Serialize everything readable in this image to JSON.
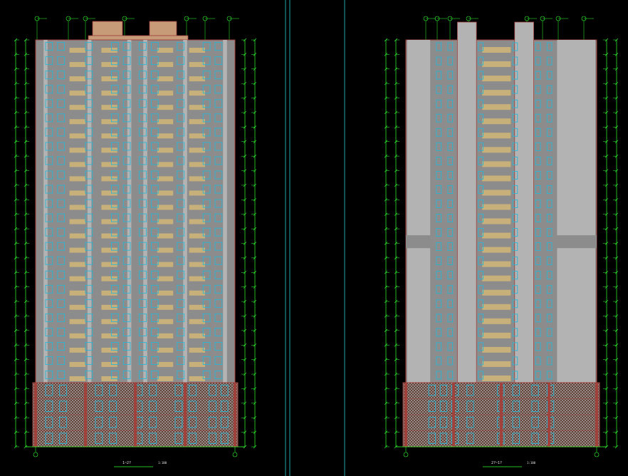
{
  "app": "CAD drawing viewer",
  "colors": {
    "background": "#000000",
    "wall": "#8c8c8c",
    "wall_light": "#b3b3b3",
    "outline": "#a0413c",
    "balcony": "#c8b07a",
    "window": "#29b6d6",
    "dimension": "#33ff33",
    "frame_line": "#1fa6a6",
    "podium_fill": "#5a3a30",
    "podium_mesh": "#b8b8b8",
    "grid_marker": "#33ff33"
  },
  "sheets": [
    {
      "name": "left-elevation",
      "title": "1~2?",
      "scale": "1:100",
      "floors": 24,
      "podium_floors": 4,
      "roof_boxes": 2
    },
    {
      "name": "right-elevation",
      "title": "2?~1?",
      "scale": "1:100",
      "floors": 24,
      "podium_floors": 4,
      "roof_boxes": 2
    }
  ]
}
